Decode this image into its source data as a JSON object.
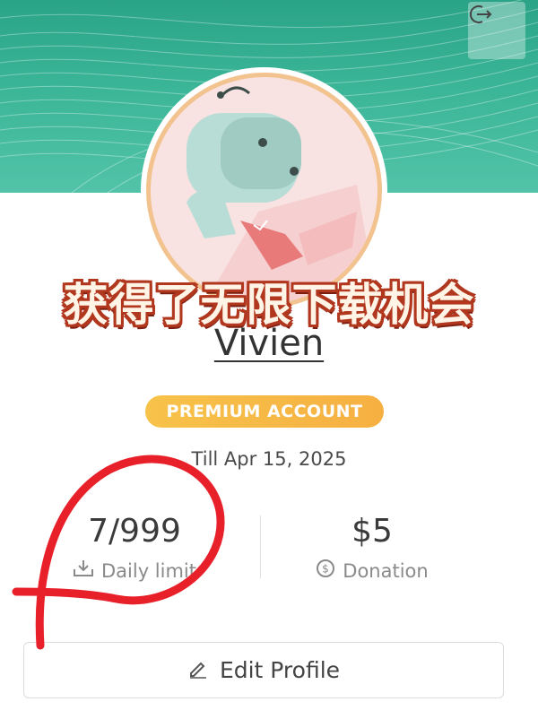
{
  "header": {
    "logout_icon": "logout-icon"
  },
  "overlay": {
    "promo_text": "获得了无限下载机会"
  },
  "profile": {
    "username": "Vivien",
    "account_badge": "PREMIUM ACCOUNT",
    "valid_until": "Till Apr 15, 2025"
  },
  "stats": {
    "daily_limit_value": "7/999",
    "daily_limit_label": "Daily limit",
    "donation_value": "$5",
    "donation_label": "Donation"
  },
  "actions": {
    "edit_profile_label": "Edit Profile"
  },
  "colors": {
    "banner": "#3bb597",
    "badge": "#f7c24a",
    "annotation": "#e8202a"
  }
}
